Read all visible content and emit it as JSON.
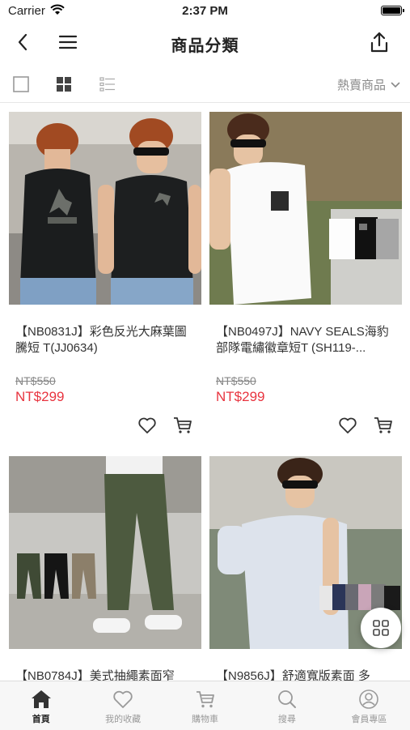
{
  "status_bar": {
    "carrier": "Carrier",
    "time": "2:37 PM"
  },
  "header": {
    "title": "商品分類",
    "back_icon": "back-icon",
    "menu_icon": "menu-icon",
    "share_icon": "share-icon"
  },
  "toolbar": {
    "sort_label": "熱賣商品",
    "view_modes": [
      "single-view-icon",
      "grid-view-icon",
      "list-view-icon"
    ],
    "active_view": "grid-view-icon"
  },
  "products": [
    {
      "name": "【NB0831J】彩色反光大麻葉圖騰短 T(JJ0634)",
      "original_price": "NT$550",
      "price": "NT$299"
    },
    {
      "name": "【NB0497J】NAVY SEALS海豹部隊電繡徽章短T (SH119-...",
      "original_price": "NT$550",
      "price": "NT$299"
    },
    {
      "name": "【NB0784J】美式抽繩素面窄",
      "original_price": "",
      "price": ""
    },
    {
      "name": "【N9856J】舒適寬版素面 多",
      "original_price": "",
      "price": ""
    }
  ],
  "tabbar": {
    "items": [
      {
        "label": "首頁",
        "icon": "home-icon"
      },
      {
        "label": "我的收藏",
        "icon": "heart-icon"
      },
      {
        "label": "購物車",
        "icon": "cart-icon"
      },
      {
        "label": "搜尋",
        "icon": "search-icon"
      },
      {
        "label": "會員專區",
        "icon": "user-icon"
      }
    ],
    "active": 0
  },
  "colors": {
    "accent_price": "#e8343f",
    "active_tab": "#222222",
    "inactive_tab": "#9a9a9a"
  }
}
